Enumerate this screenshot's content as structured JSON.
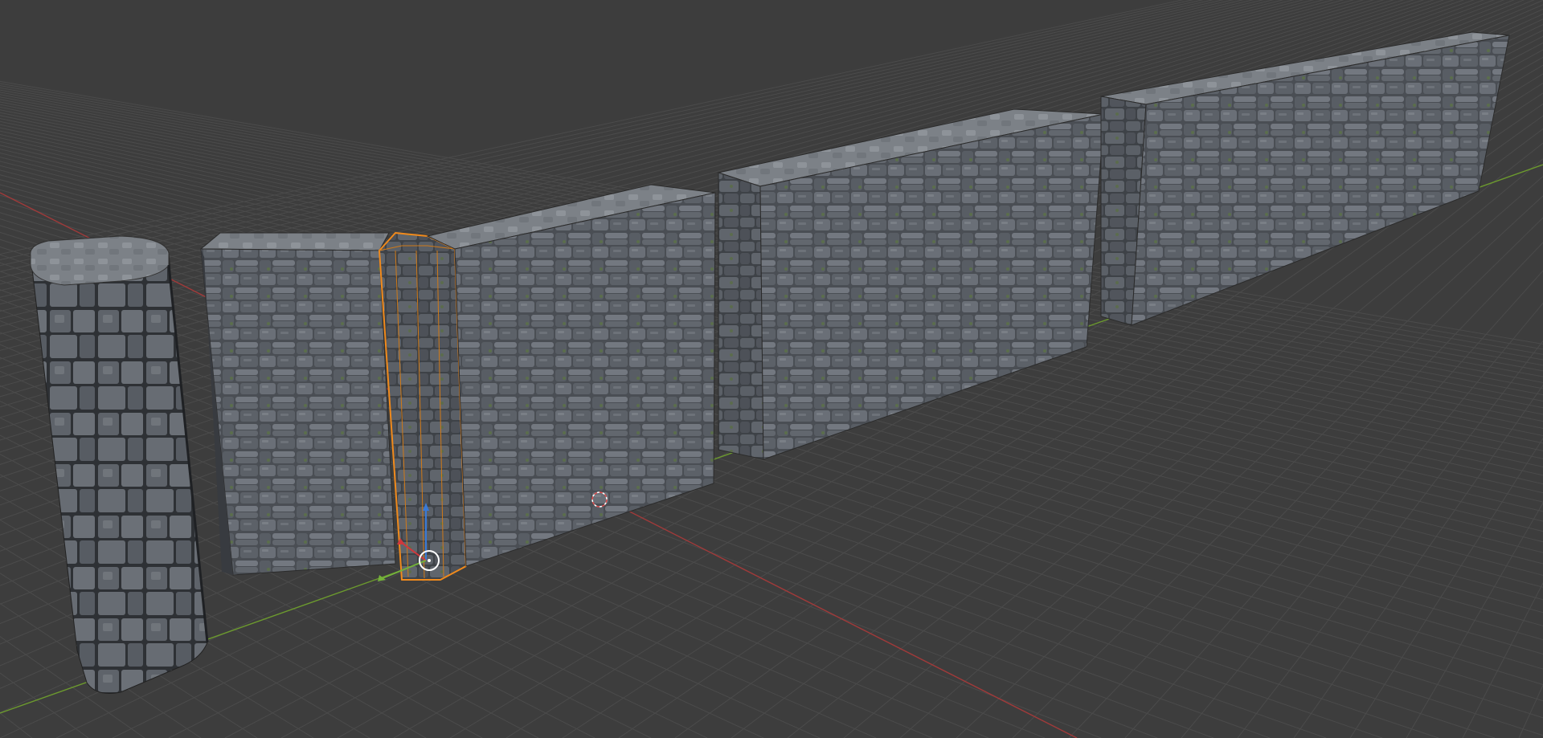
{
  "app": "3D viewport",
  "viewport": {
    "background": "#3d3d3d",
    "grid_color": "#4b4b4b",
    "x_axis_color": "#a03a3a",
    "y_axis_color": "#6c9a2e",
    "selection_color": "#f08a1c"
  },
  "objects": [
    {
      "id": "pillar",
      "type": "cylinder",
      "material": "stone-brick",
      "selected": false
    },
    {
      "id": "wall-corner",
      "type": "wall-segment",
      "material": "stone-brick",
      "selected": false
    },
    {
      "id": "wall-post",
      "type": "beveled-column",
      "material": "stone-brick",
      "selected": true
    },
    {
      "id": "wall-1",
      "type": "wall-segment",
      "material": "stone-brick",
      "selected": false
    },
    {
      "id": "wall-2",
      "type": "wall-segment",
      "material": "stone-brick",
      "selected": false
    },
    {
      "id": "wall-3",
      "type": "wall-segment",
      "material": "stone-brick",
      "selected": false
    }
  ],
  "gizmo": {
    "axes": [
      "x",
      "y",
      "z"
    ],
    "icon": "transform-gizmo-icon"
  },
  "cursor": {
    "icon": "3d-cursor-icon"
  }
}
